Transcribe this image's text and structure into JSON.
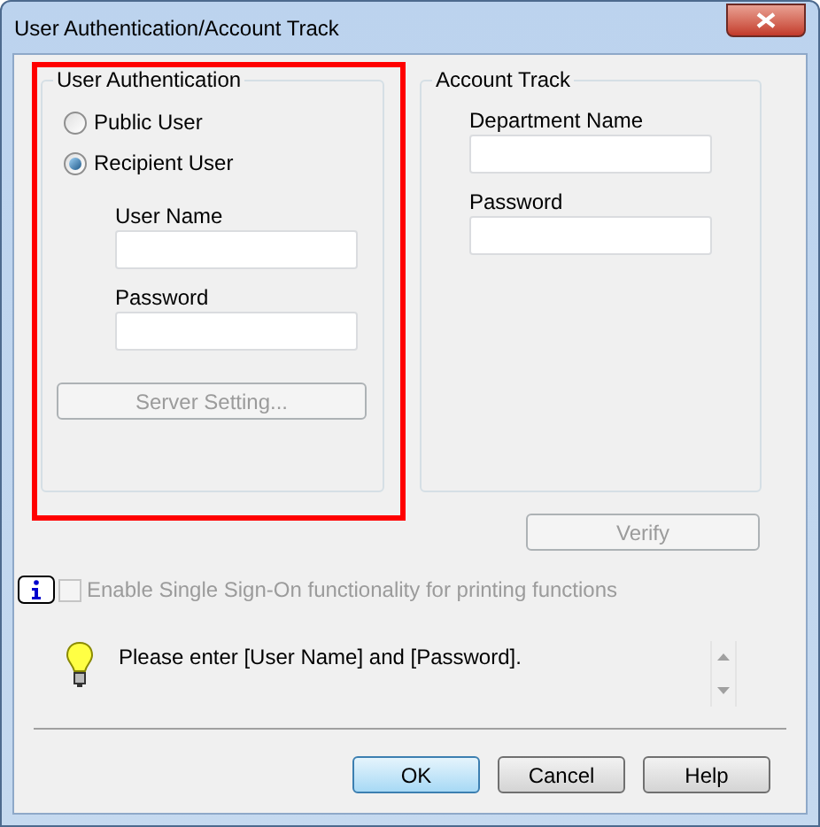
{
  "window": {
    "title": "User Authentication/Account Track"
  },
  "user_authentication": {
    "title": "User Authentication",
    "options": [
      {
        "label": "Public User",
        "selected": false
      },
      {
        "label": "Recipient User",
        "selected": true
      }
    ],
    "fields": [
      {
        "label": "User Name"
      },
      {
        "label": "Password"
      }
    ],
    "server_button": {
      "label": "Server Setting...",
      "disabled": true
    }
  },
  "account_track": {
    "title": "Account Track",
    "fields": [
      {
        "label": "Department Name"
      },
      {
        "label": "Password"
      }
    ]
  },
  "verify_button": {
    "label": "Verify",
    "disabled": true
  },
  "single_sign_on": {
    "label": "Enable Single Sign-On functionality for printing functions",
    "checked": false,
    "disabled": true
  },
  "message": "Please enter [User Name] and [Password].",
  "buttons": [
    {
      "label": "OK",
      "default": true
    },
    {
      "label": "Cancel",
      "default": false
    },
    {
      "label": "Help",
      "default": false
    }
  ]
}
